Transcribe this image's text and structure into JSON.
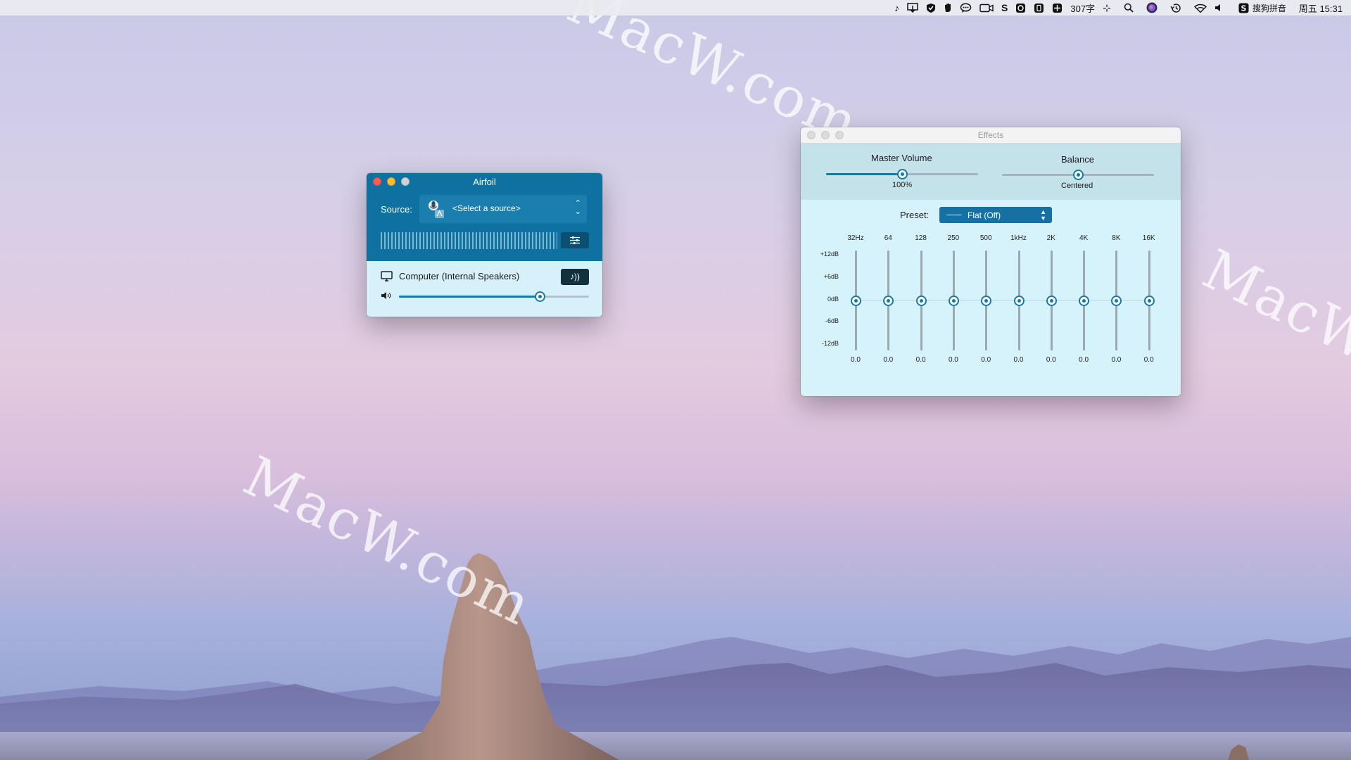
{
  "menubar": {
    "word_count": "307字",
    "input_method": "搜狗拼音",
    "datetime": "周五 15:31",
    "icons": [
      "music-note-icon",
      "screen-share-icon",
      "shield-check-icon",
      "hand-icon",
      "chat-bubble-icon",
      "camera-icon",
      "s-logo-icon",
      "browser-icon",
      "phone-icon",
      "grid-icon",
      "word-count",
      "dial-icon",
      "search-icon",
      "siri-icon",
      "time-machine-icon",
      "wifi-icon",
      "volume-icon",
      "sogou-icon"
    ]
  },
  "watermark": "MacW.com",
  "airfoil": {
    "title": "Airfoil",
    "source_label": "Source:",
    "source_value": "<Select a source>",
    "speaker_name": "Computer (Internal Speakers)",
    "speaker_volume": 0.74,
    "colors": {
      "header": "#0f71a0",
      "body": "#d7f1fb",
      "accent": "#157aa6"
    }
  },
  "effects": {
    "title": "Effects",
    "master_volume_label": "Master Volume",
    "master_volume_value": "100%",
    "master_volume_level": 0.5,
    "balance_label": "Balance",
    "balance_value": "Centered",
    "balance_level": 0.5,
    "preset_label": "Preset:",
    "preset_value": "Flat (Off)",
    "db_scale": [
      "+12dB",
      "+6dB",
      "0dB",
      "-6dB",
      "-12dB"
    ],
    "bands": [
      {
        "freq": "32Hz",
        "gain": "0.0"
      },
      {
        "freq": "64",
        "gain": "0.0"
      },
      {
        "freq": "128",
        "gain": "0.0"
      },
      {
        "freq": "250",
        "gain": "0.0"
      },
      {
        "freq": "500",
        "gain": "0.0"
      },
      {
        "freq": "1kHz",
        "gain": "0.0"
      },
      {
        "freq": "2K",
        "gain": "0.0"
      },
      {
        "freq": "4K",
        "gain": "0.0"
      },
      {
        "freq": "8K",
        "gain": "0.0"
      },
      {
        "freq": "16K",
        "gain": "0.0"
      }
    ]
  }
}
